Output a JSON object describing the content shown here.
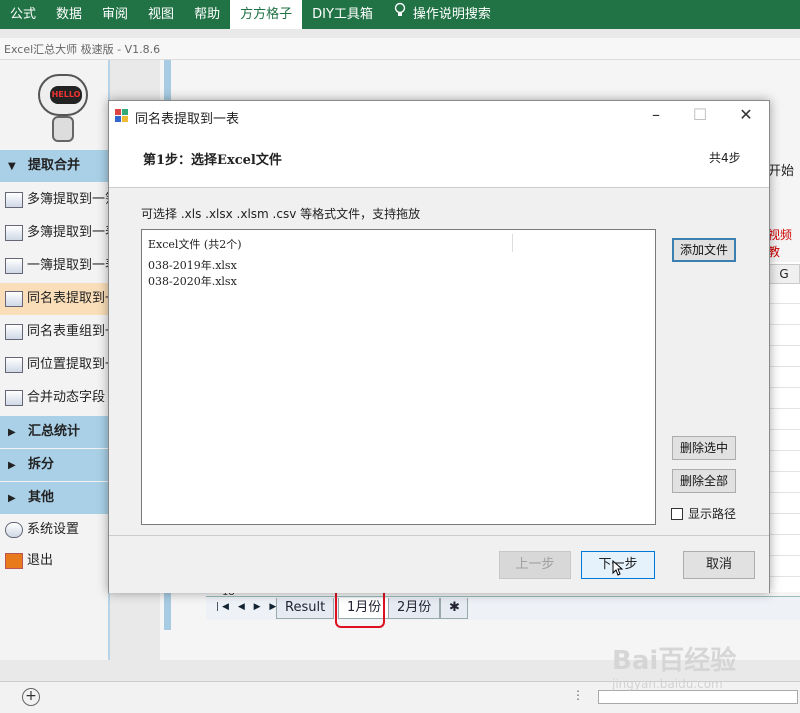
{
  "ribbon": {
    "tabs": [
      "公式",
      "数据",
      "审阅",
      "视图",
      "帮助",
      "方方格子",
      "DIY工具箱"
    ],
    "active_tab": "方方格子",
    "search_label": "操作说明搜索"
  },
  "app_title": "Excel汇总大师 极速版 - V1.8.6",
  "robot_face": "HELLO",
  "sidebar": {
    "section_extract": "提取合并",
    "items": [
      "多簿提取到一簿",
      "多簿提取到一表",
      "一簿提取到一表",
      "同名表提取到一表",
      "同名表重组到一簿",
      "同位置提取到一表",
      "合并动态字段"
    ],
    "selected_index": 3,
    "section_stats": "汇总统计",
    "section_split": "拆分",
    "section_other": "其他",
    "settings": "系统设置",
    "exit": "退出"
  },
  "behind": {
    "start_button": "开始",
    "video_link": "视频教",
    "column_g": "G",
    "row_18": "18"
  },
  "sheet_tabs": [
    "Result",
    "1月份",
    "2月份"
  ],
  "sheet_active": "1月份",
  "dialog": {
    "title": "同名表提取到一表",
    "step_title": "第1步：选择Excel文件",
    "step_count": "共4步",
    "hint": "可选择 .xls  .xlsx  .xlsm .csv 等格式文件，支持拖放",
    "list_header": "Excel文件 (共2个)",
    "files": [
      "038-2019年.xlsx",
      "038-2020年.xlsx"
    ],
    "add_file": "添加文件",
    "delete_selected": "删除选中",
    "delete_all": "删除全部",
    "show_path": "显示路径",
    "prev": "上一步",
    "next": "下一步",
    "cancel": "取消"
  },
  "watermark": {
    "brand": "Bai百经验",
    "url": "jingyan.baidu.com"
  },
  "colors": {
    "ribbon": "#217346",
    "section": "#a9d0e7",
    "selected_item": "#f9deb9",
    "highlight_red": "#d12222"
  }
}
